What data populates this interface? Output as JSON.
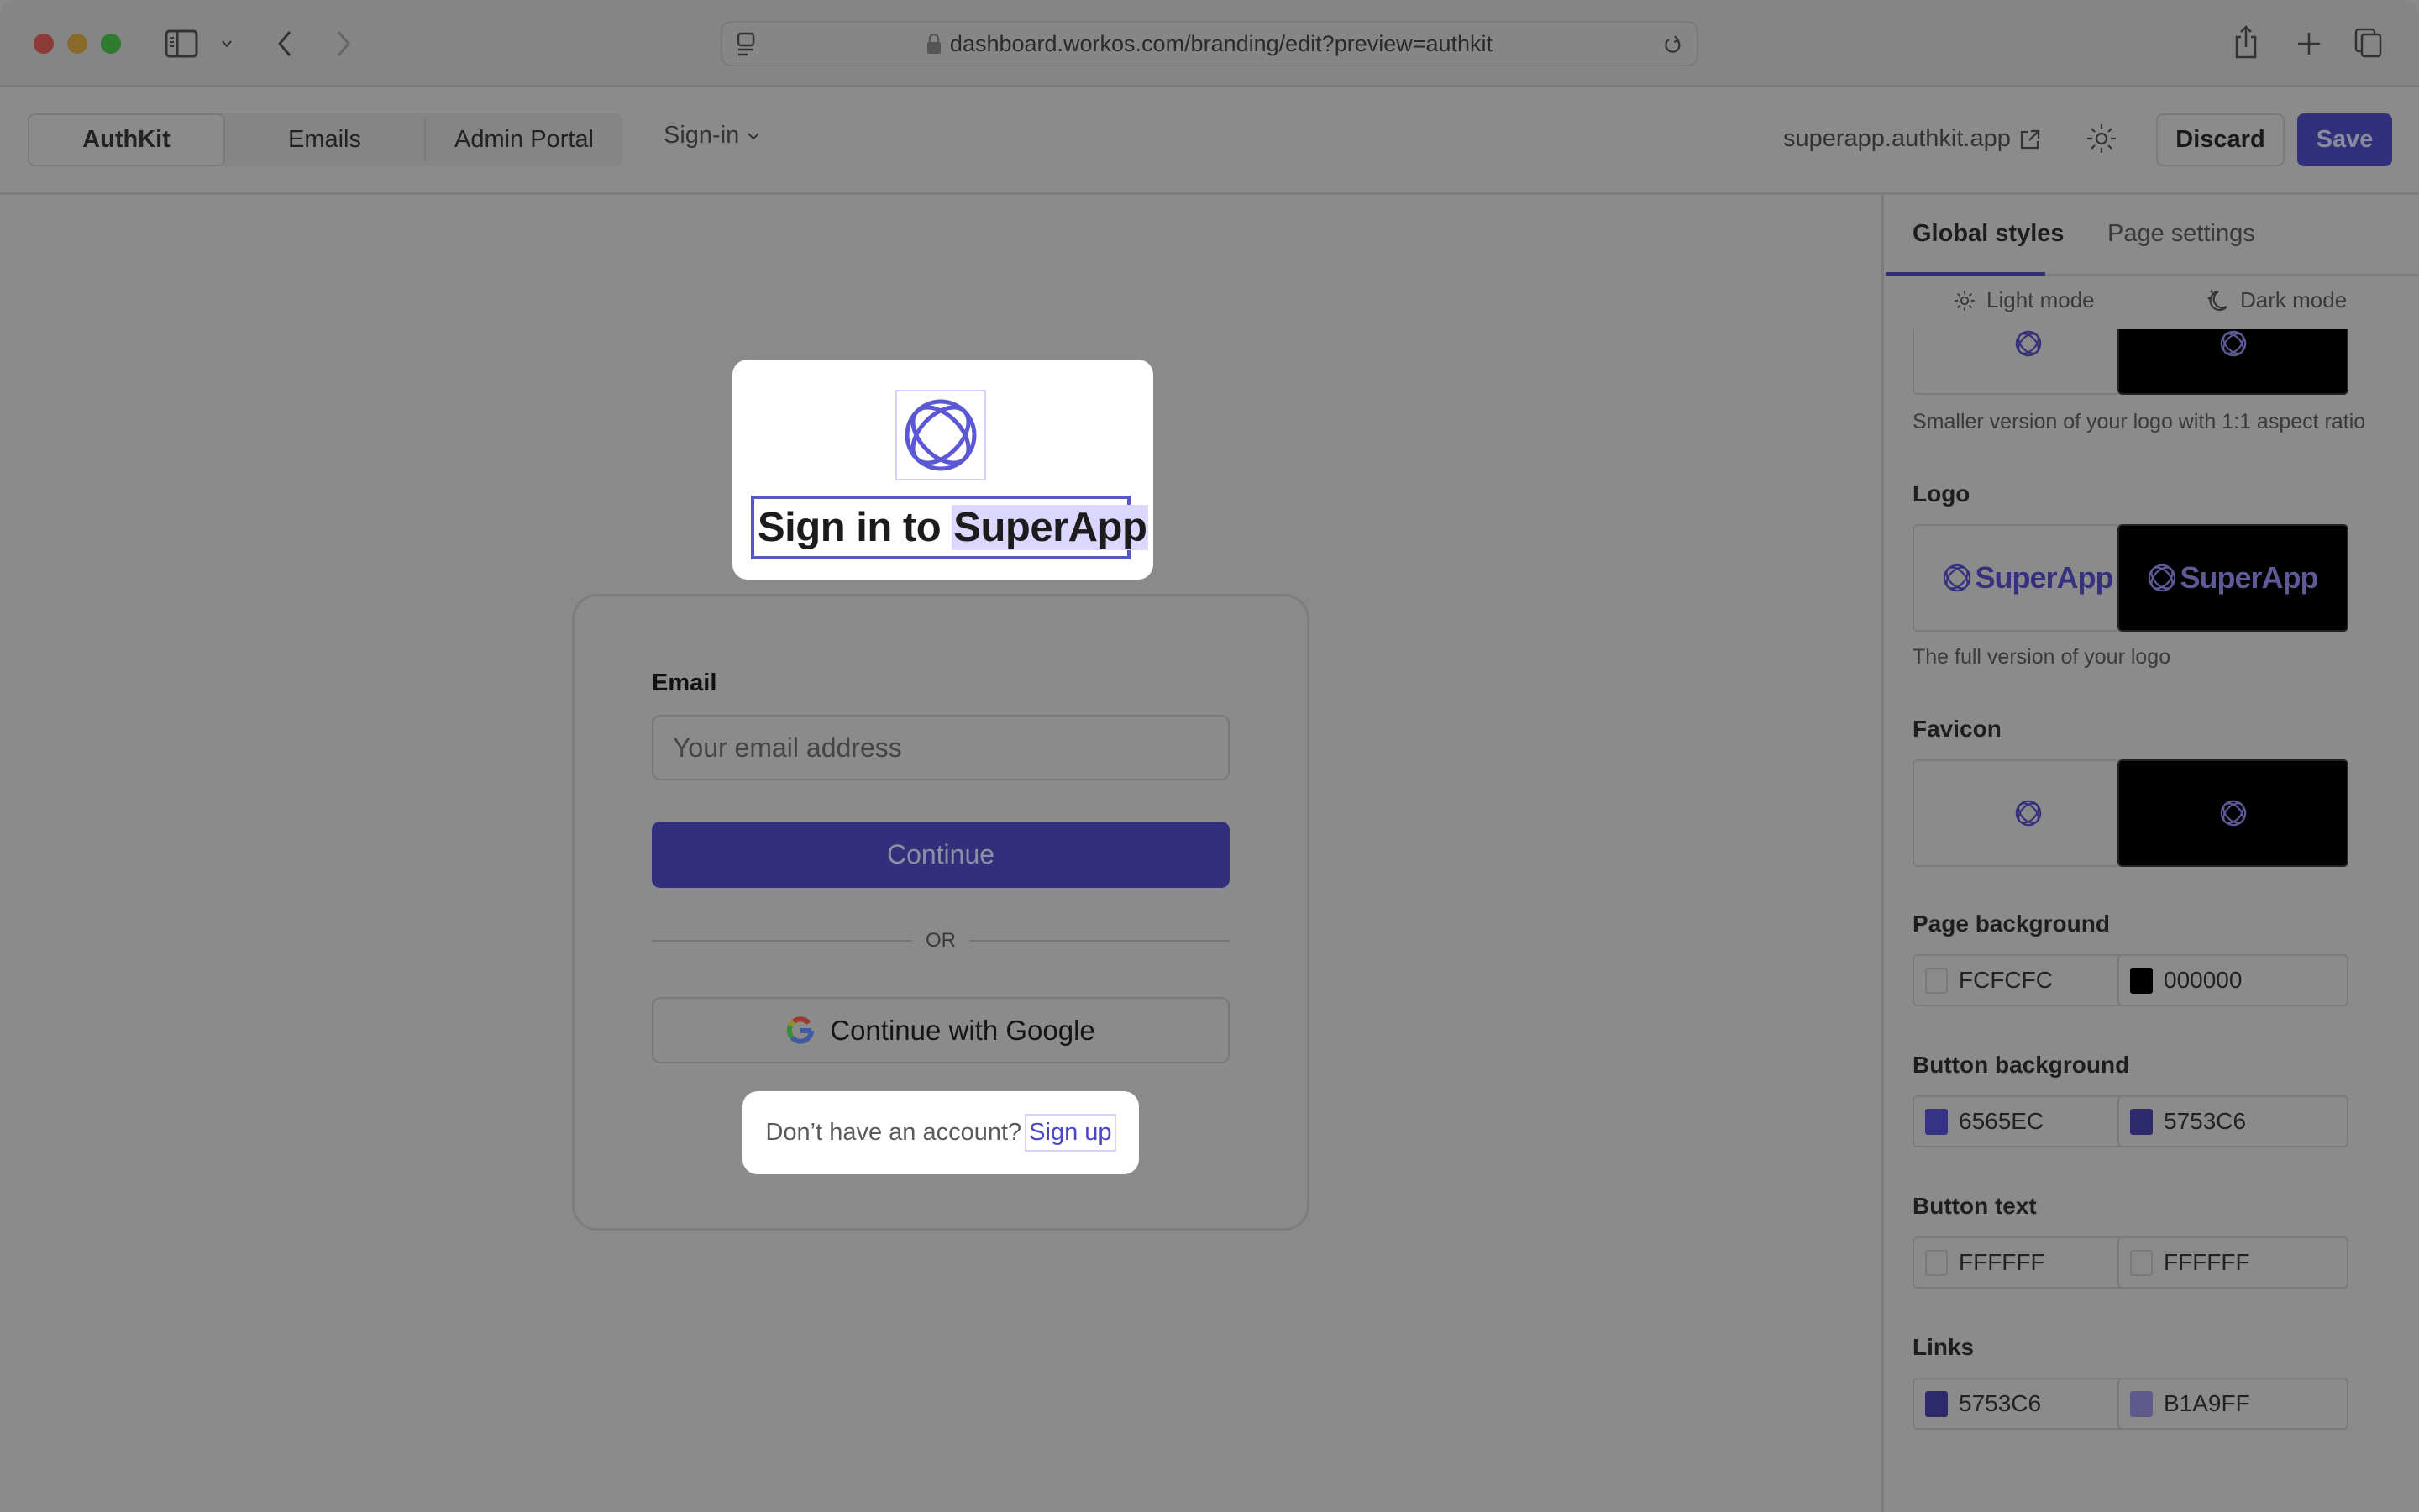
{
  "browser": {
    "url": "dashboard.workos.com/branding/edit?preview=authkit",
    "traffic_lights": [
      "#8b3a35",
      "#8a6a2a",
      "#2e7a2e"
    ]
  },
  "toolbar": {
    "segments": [
      {
        "label": "AuthKit",
        "active": true
      },
      {
        "label": "Emails",
        "active": false
      },
      {
        "label": "Admin Portal",
        "active": false
      }
    ],
    "page_select": "Sign-in",
    "domain_link": "superapp.authkit.app",
    "discard_label": "Discard",
    "save_label": "Save"
  },
  "preview": {
    "heading_prefix": "Sign in to ",
    "heading_app": "SuperApp",
    "email_label": "Email",
    "email_placeholder": "Your email address",
    "continue_label": "Continue",
    "or_label": "OR",
    "google_label": "Continue with Google",
    "signup_question": "Don’t have an account?",
    "signup_link": "Sign up"
  },
  "panel": {
    "tabs": [
      {
        "label": "Global styles",
        "active": true
      },
      {
        "label": "Page settings",
        "active": false
      }
    ],
    "light_mode_label": "Light mode",
    "dark_mode_label": "Dark mode",
    "logo_icon_desc": "Smaller version of your logo with 1:1 aspect ratio",
    "logo_title": "Logo",
    "logo_word": "SuperApp",
    "logo_desc": "The full version of your logo",
    "favicon_title": "Favicon",
    "colors": [
      {
        "title": "Page background",
        "light": "FCFCFC",
        "dark": "000000",
        "light_swatch": "#8a8a8a",
        "dark_swatch": "#000000"
      },
      {
        "title": "Button background",
        "light": "6565EC",
        "dark": "5753C6",
        "light_swatch": "#363387",
        "dark_swatch": "#2e2a6b"
      },
      {
        "title": "Button text",
        "light": "FFFFFF",
        "dark": "FFFFFF",
        "light_swatch": "#8a8a8a",
        "dark_swatch": "#8a8a8a"
      },
      {
        "title": "Links",
        "light": "5753C6",
        "dark": "B1A9FF",
        "light_swatch": "#2e2a6b",
        "dark_swatch": "#5e5a8c"
      }
    ]
  },
  "brand_colors": {
    "accent": "#5a56c8",
    "accent_dimmed": "#332f7c",
    "highlight": "#dcd7ff"
  }
}
